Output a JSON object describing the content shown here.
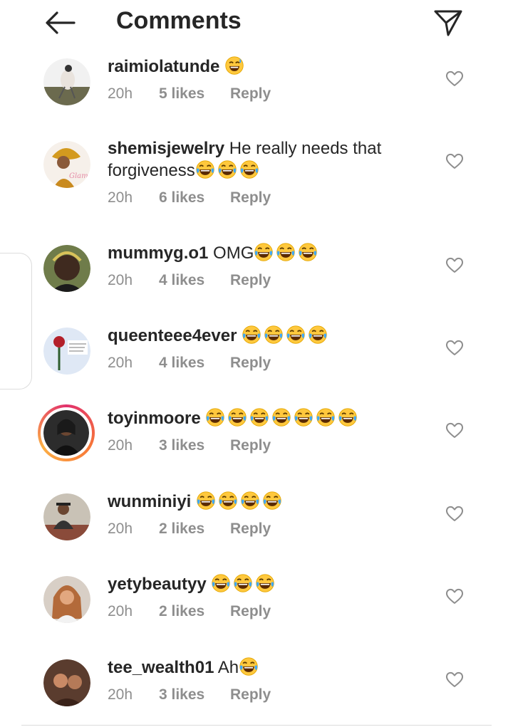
{
  "header": {
    "title": "Comments"
  },
  "icons": {
    "back": "arrow-left-icon",
    "send": "paper-plane-icon",
    "heart": "heart-outline-icon",
    "laugh": "laughing-tears-emoji",
    "sweat": "grinning-sweat-emoji"
  },
  "colors": {
    "text": "#262626",
    "muted": "#8e8e8e",
    "story_ring": "#e1306c"
  },
  "comments": [
    {
      "username": "raimiolatunde",
      "text": "",
      "time": "20h",
      "likes": "5 likes",
      "reply": "Reply"
    },
    {
      "username": "shemisjewelry",
      "text": "He really needs that forgiveness",
      "time": "20h",
      "likes": "6 likes",
      "reply": "Reply"
    },
    {
      "username": "mummyg.o1",
      "text": "OMG",
      "time": "20h",
      "likes": "4 likes",
      "reply": "Reply"
    },
    {
      "username": "queenteee4ever",
      "text": "",
      "time": "20h",
      "likes": "4 likes",
      "reply": "Reply"
    },
    {
      "username": "toyinmoore",
      "text": "",
      "time": "20h",
      "likes": "3 likes",
      "reply": "Reply"
    },
    {
      "username": "wunminiyi",
      "text": "",
      "time": "20h",
      "likes": "2 likes",
      "reply": "Reply"
    },
    {
      "username": "yetybeautyy",
      "text": "",
      "time": "20h",
      "likes": "2 likes",
      "reply": "Reply"
    },
    {
      "username": "tee_wealth01",
      "text": "Ah",
      "time": "20h",
      "likes": "3 likes",
      "reply": "Reply"
    }
  ]
}
